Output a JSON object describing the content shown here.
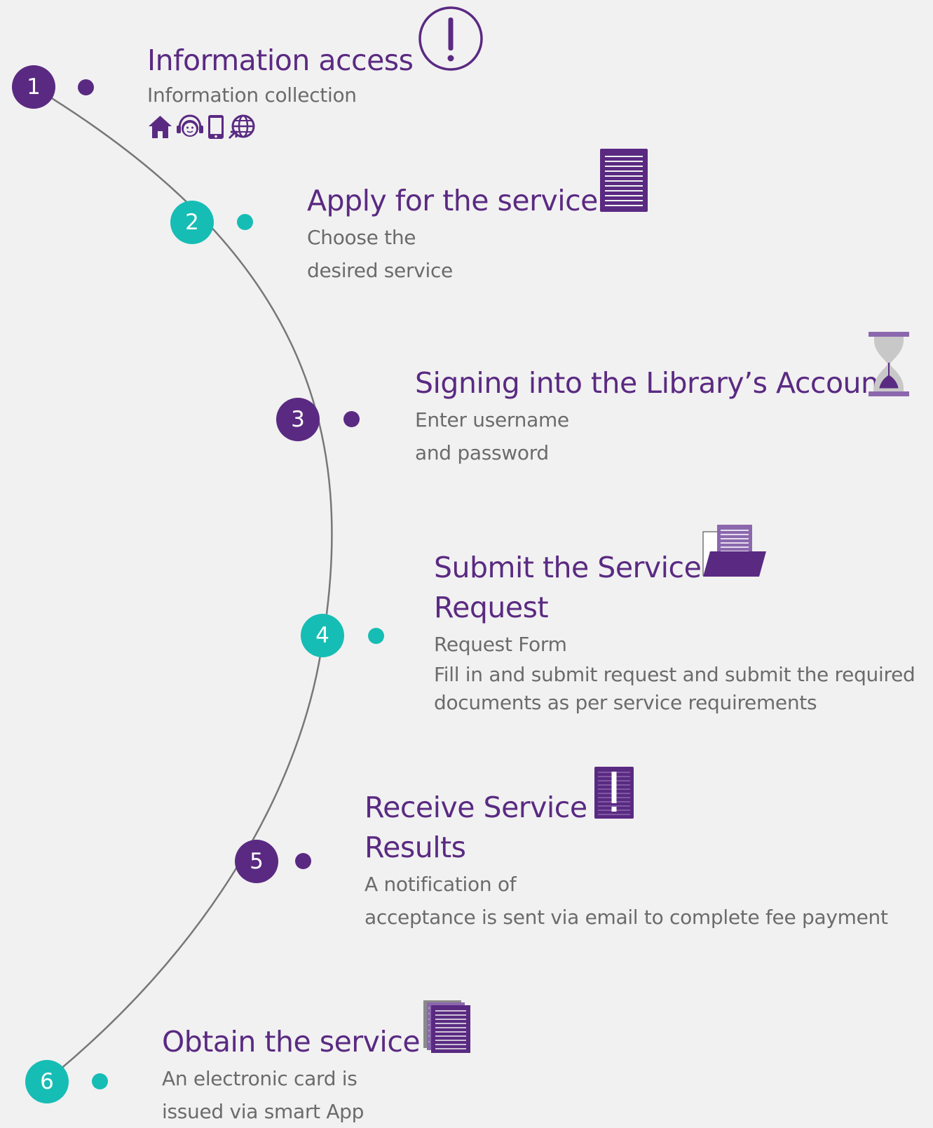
{
  "colors": {
    "purple": "#5a2a82",
    "teal": "#16bdb4",
    "line": "#777777",
    "title": "#5a2a82",
    "text": "#6b6b6b",
    "background": "#f1f1f1"
  },
  "steps": [
    {
      "number": "1",
      "title": "Information access",
      "lines": [
        "Information collection"
      ],
      "icon": "exclamation-circle-icon",
      "node_color": "purple"
    },
    {
      "number": "2",
      "title": "Apply for the service",
      "lines": [
        "Choose the",
        "desired service"
      ],
      "icon": "document-icon",
      "node_color": "teal"
    },
    {
      "number": "3",
      "title": "Signing into the Library’s Account",
      "lines": [
        "Enter username",
        "and password"
      ],
      "icon": "hourglass-icon",
      "node_color": "purple"
    },
    {
      "number": "4",
      "title_lines": [
        "Submit the Service",
        "Request"
      ],
      "lines": [
        "Request Form"
      ],
      "detail_lines": [
        "Fill in and submit request and submit the required",
        "documents as per service requirements"
      ],
      "icon": "folder-documents-icon",
      "node_color": "teal"
    },
    {
      "number": "5",
      "title_lines": [
        "Receive Service",
        "Results"
      ],
      "lines": [
        "A notification of",
        "acceptance is sent via email to complete fee payment"
      ],
      "icon": "notice-document-icon",
      "node_color": "purple"
    },
    {
      "number": "6",
      "title": "Obtain the service",
      "lines": [
        "An electronic card is",
        "issued via smart App"
      ],
      "icon": "document-stack-icon",
      "node_color": "teal"
    }
  ],
  "channel_icons": [
    "home-icon",
    "customer-service-icon",
    "smartphone-icon",
    "globe-icon"
  ]
}
